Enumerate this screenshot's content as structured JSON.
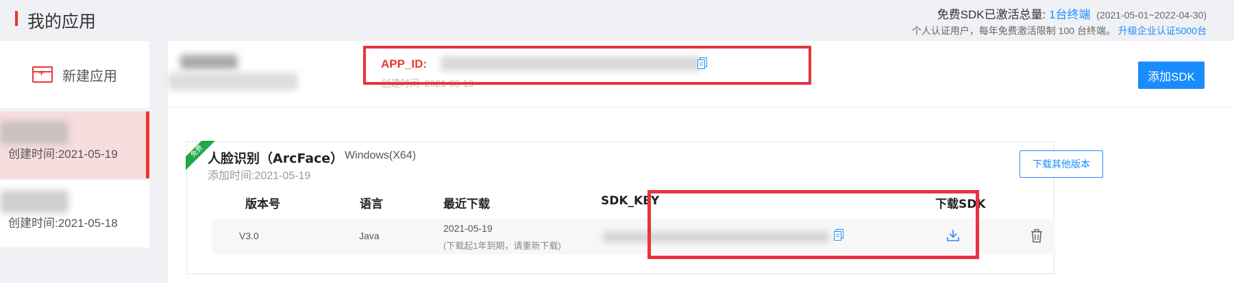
{
  "header": {
    "title": "我的应用",
    "quota_label": "免费SDK已激活总量:",
    "quota_value": "1台终端",
    "quota_range": "(2021-05-01~2022-04-30)",
    "quota_note": "个人认证用户，每年免费激活限制 100 台终端。",
    "upgrade_link": "升级企业认证5000台"
  },
  "sidebar": {
    "new_app_label": "新建应用",
    "apps": [
      {
        "created": "创建时间:2021-05-19",
        "active": true
      },
      {
        "created": "创建时间:2021-05-18",
        "active": false
      }
    ]
  },
  "app": {
    "appid_label": "APP_ID:",
    "created": "创建时间: 2021-05-19",
    "add_sdk_label": "添加SDK"
  },
  "sdk": {
    "free_badge": "免费",
    "title": "人脸识别（ArcFace）",
    "platform": "Windows(X64)",
    "added": "添加时间:2021-05-19",
    "download_other_label": "下载其他版本",
    "columns": [
      "版本号",
      "语言",
      "最近下载",
      "SDK_KEY",
      "下载SDK"
    ],
    "row": {
      "version": "V3.0",
      "language": "Java",
      "last_download": "2021-05-19",
      "expiry_note": "(下载起1年到期，请重新下载)"
    }
  },
  "colors": {
    "accent_red": "#e8382f",
    "accent_blue": "#1a8cff",
    "free_green": "#21a844"
  }
}
